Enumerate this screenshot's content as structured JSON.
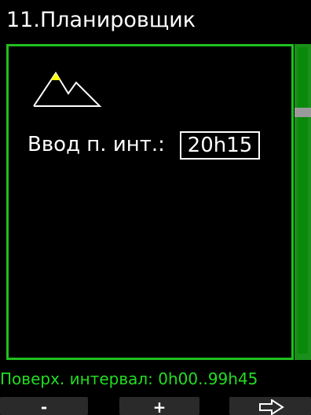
{
  "header": {
    "title": "11.Планировщик"
  },
  "panel": {
    "mountain_icon": "mountain-altitude-icon",
    "field_label": "Ввод п. инт.:",
    "field_value": "20h15"
  },
  "status": {
    "text": "Поверх. интервал: 0h00..99h45"
  },
  "softkeys": {
    "left_label": "-",
    "mid_label": "+",
    "right_icon": "arrow-right-icon"
  },
  "colors": {
    "accent_green": "#1fbf1f",
    "status_green": "#22dd22",
    "mountain_peak": "#ffff00"
  }
}
